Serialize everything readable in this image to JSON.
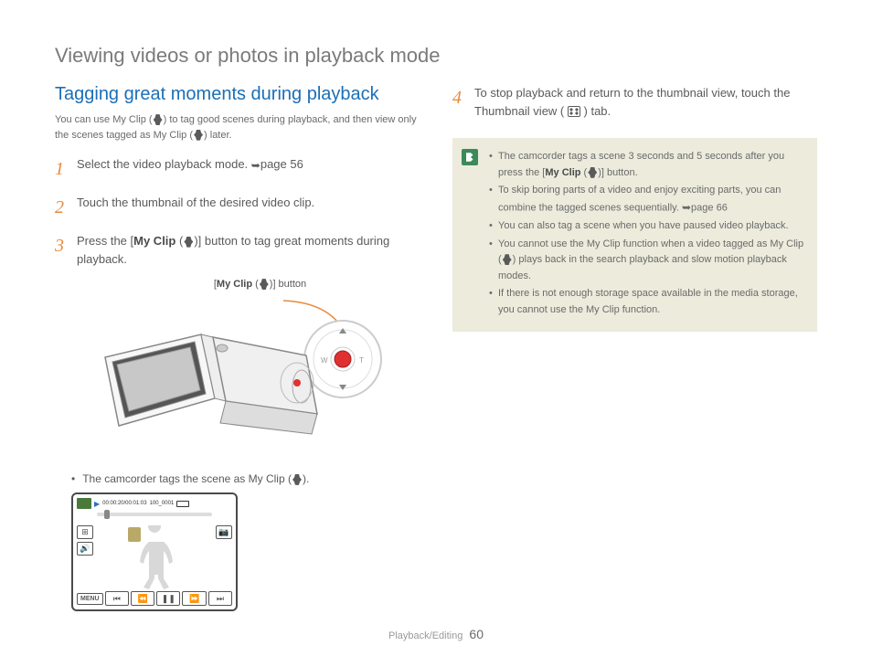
{
  "page_title": "Viewing videos or photos in playback mode",
  "section_heading": "Tagging great moments during playback",
  "intro_text_1": "You can use My Clip (",
  "intro_text_2": ") to tag good scenes during playback, and then view only the scenes tagged as My Clip (",
  "intro_text_3": ") later.",
  "steps": {
    "s1": {
      "num": "1",
      "text_a": "Select the video playback mode. ",
      "page_ref": "page 56"
    },
    "s2": {
      "num": "2",
      "text": "Touch the thumbnail of the desired video clip."
    },
    "s3": {
      "num": "3",
      "text_a": "Press the [",
      "bold": "My Clip",
      "text_b": " (",
      "text_c": ")] button to tag great moments during playback."
    },
    "s4": {
      "num": "4",
      "text_a": "To stop playback and return to the thumbnail view, touch the Thumbnail view (",
      "text_b": ") tab."
    }
  },
  "callout_label_a": "[",
  "callout_label_bold": "My Clip",
  "callout_label_b": " (",
  "callout_label_c": ")] button",
  "bullet_left_a": "The camcorder tags the scene as My Clip (",
  "bullet_left_b": ").",
  "playback_screen": {
    "time": "00:00:20/00:01:03",
    "file": "100_0001",
    "menu": "MENU",
    "zoom_w": "W",
    "zoom_t": "T"
  },
  "notes": {
    "n1_a": "The camcorder tags a scene 3 seconds and 5 seconds after you press the [",
    "n1_bold": "My Clip",
    "n1_b": " (",
    "n1_c": ")] button.",
    "n2_a": "To skip boring parts of a video and enjoy exciting parts, you can combine the tagged scenes sequentially. ",
    "n2_ref": "page 66",
    "n3": "You can also tag a scene when you have paused video playback.",
    "n4_a": "You cannot use the My Clip function when a video tagged as My Clip (",
    "n4_b": ") plays back in the search playback and slow motion playback modes.",
    "n5": "If there is not enough storage space available in the media storage, you cannot use the My Clip function."
  },
  "footer": {
    "section": "Playback/Editing",
    "page": "60"
  }
}
